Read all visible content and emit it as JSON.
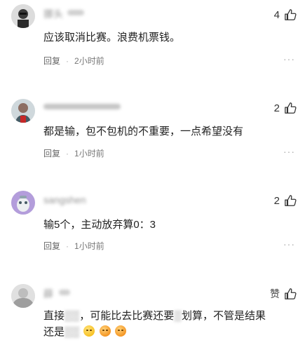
{
  "comments": [
    {
      "username": "挪头",
      "likes": "4",
      "text": "应该取消比赛。浪费机票钱。",
      "reply_label": "回复",
      "time": "2小时前",
      "more": "···"
    },
    {
      "username": "",
      "likes": "2",
      "text": "都是输，包不包机的不重要，一点希望没有",
      "reply_label": "回复",
      "time": "1小时前",
      "more": "···"
    },
    {
      "username": "sangshen",
      "likes": "2",
      "text": "输5个，主动放弃算0：3",
      "reply_label": "回复",
      "time": "1小时前",
      "more": "···"
    },
    {
      "username": "薛",
      "likes_label": "赞",
      "text_line1_a": "直接",
      "text_line1_b": "，可能比去比赛还要",
      "text_line1_c": "划算，不管是结果",
      "text_line2": "还是"
    }
  ],
  "colors": {
    "text": "#222222",
    "meta": "#777777",
    "icon": "#333333"
  },
  "icons": [
    "thumbs-up-icon",
    "more-icon",
    "emoji-icon"
  ]
}
